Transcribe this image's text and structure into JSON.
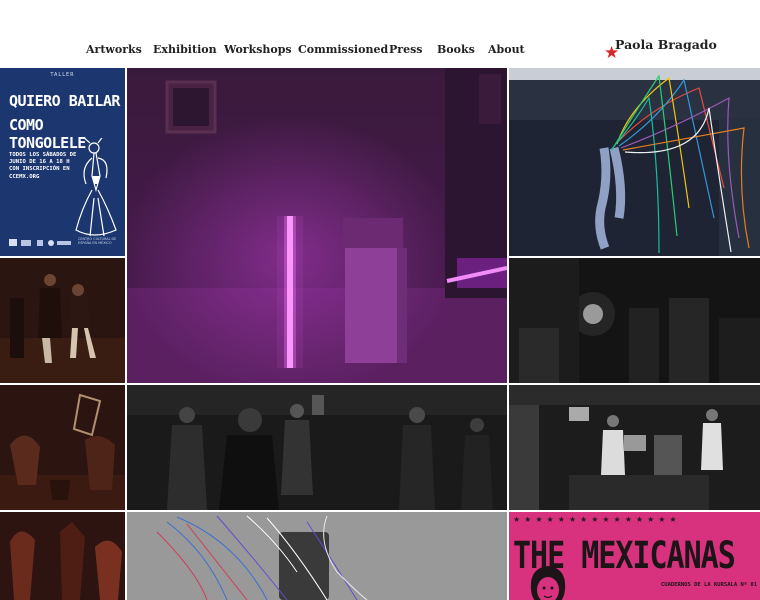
{
  "header": {
    "nav": [
      {
        "label": "Artworks"
      },
      {
        "label": "Exhibition"
      },
      {
        "label": "Workshops"
      },
      {
        "label": "Commissioned"
      },
      {
        "label": "Press"
      },
      {
        "label": "Books"
      },
      {
        "label": "About"
      }
    ],
    "brand": {
      "name": "Paola Bragado",
      "star": "★",
      "star_color": "#d9262a"
    }
  },
  "gallery": {
    "poster": {
      "taller": "TALLER",
      "title_line1": "QUIERO BAILAR",
      "title_line2": "COMO TONGOLELE",
      "info": "TODOS LOS SÁBADOS DE JUNIO DE 16 A 18 H CON INSCRIPCIÓN EN CCEMX.ORG",
      "org": "CENTRO CULTURAL DE ESPAÑA EN MÉXICO"
    },
    "mexicanas": {
      "title": "THE MEXICANAS",
      "subtitle": "CUADERNOS DE LA KURSALA Nº 01",
      "stars": "★★★★★★★★★★★★★★★"
    },
    "tiles": [
      {
        "name": "poster-tile",
        "icon": "poster"
      },
      {
        "name": "neon-installation-tile",
        "icon": "neon-light"
      },
      {
        "name": "colored-threads-dancer-tile",
        "icon": "threads"
      },
      {
        "name": "dance-couple-tile",
        "icon": "photo"
      },
      {
        "name": "dark-club-tile",
        "icon": "photo"
      },
      {
        "name": "chairs-dance-tile",
        "icon": "photo"
      },
      {
        "name": "dance-crowd-tile",
        "icon": "photo"
      },
      {
        "name": "musicians-stage-tile",
        "icon": "photo"
      },
      {
        "name": "red-dancers-tile",
        "icon": "photo"
      },
      {
        "name": "threads-sign-tile",
        "icon": "threads"
      },
      {
        "name": "the-mexicanas-tile",
        "icon": "book-cover"
      }
    ]
  }
}
